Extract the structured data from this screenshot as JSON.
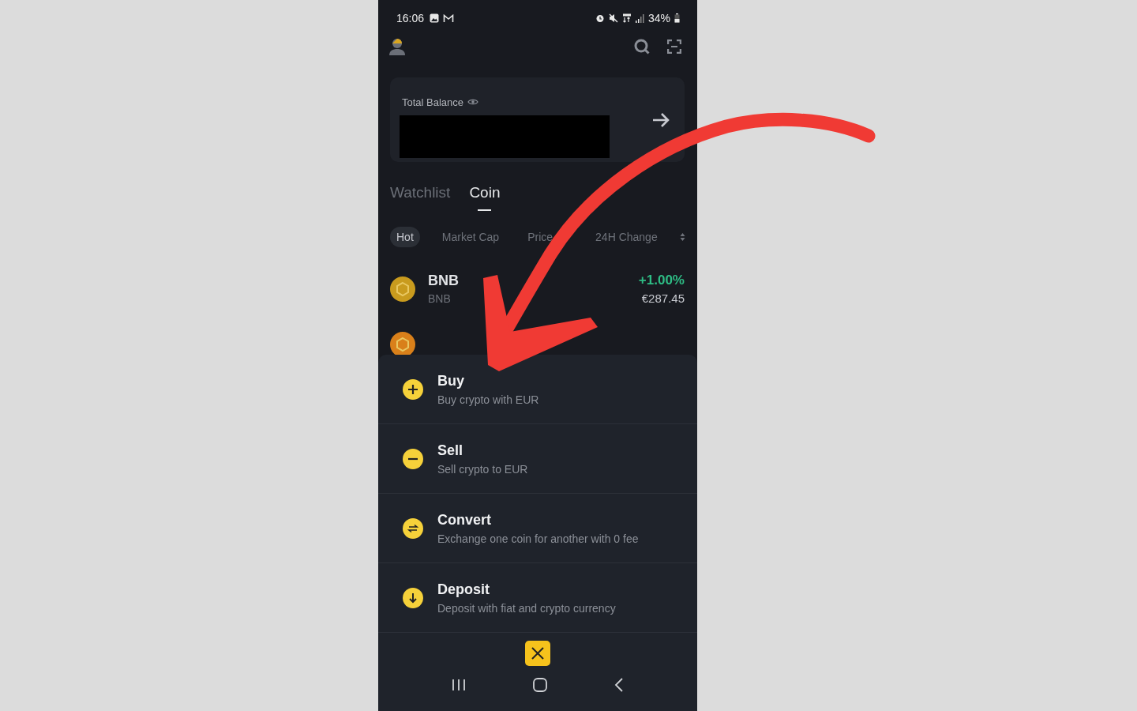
{
  "status_bar": {
    "time": "16:06",
    "battery": "34%"
  },
  "balance_card": {
    "label": "Total Balance"
  },
  "tabs": [
    {
      "label": "Watchlist",
      "selected": false
    },
    {
      "label": "Coin",
      "selected": true
    }
  ],
  "filters": [
    {
      "label": "Hot",
      "selected": true
    },
    {
      "label": "Market Cap",
      "selected": false
    },
    {
      "label": "Price",
      "selected": false
    },
    {
      "label": "24H Change",
      "selected": false
    }
  ],
  "coins": [
    {
      "name": "BNB",
      "symbol": "BNB",
      "change": "+1.00%",
      "price": "€287.45",
      "color": "#c99b1e"
    },
    {
      "color": "#d9801a"
    }
  ],
  "action_sheet": {
    "items": [
      {
        "title": "Buy",
        "subtitle": "Buy crypto with EUR"
      },
      {
        "title": "Sell",
        "subtitle": "Sell crypto to EUR"
      },
      {
        "title": "Convert",
        "subtitle": "Exchange one coin for another with 0 fee"
      },
      {
        "title": "Deposit",
        "subtitle": "Deposit with fiat and crypto currency"
      }
    ]
  }
}
